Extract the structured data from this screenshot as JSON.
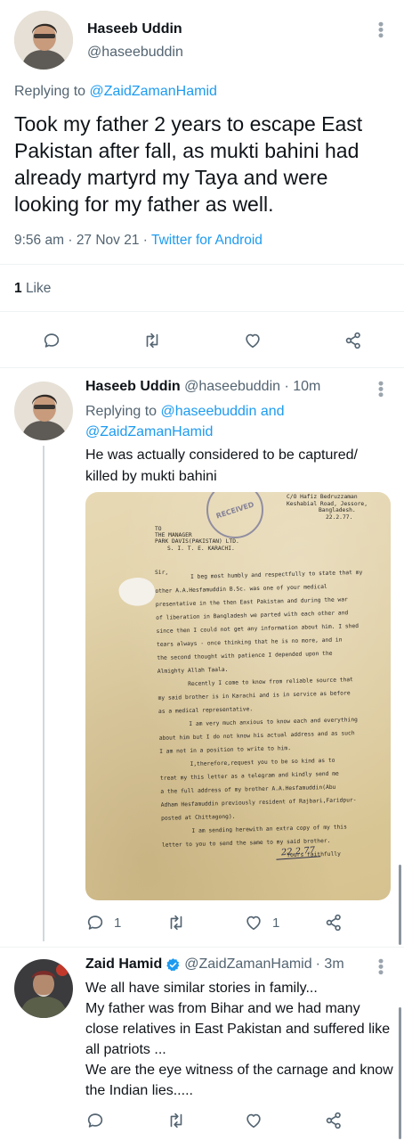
{
  "main_tweet": {
    "author_name": "Haseeb Uddin",
    "handle": "@haseebuddin",
    "replying_prefix": "Replying to",
    "replying_to": "@ZaidZamanHamid",
    "text": "Took my father 2 years to escape East Pakistan after fall, as mukti bahini had already martyrd my Taya and were looking for my father as well.",
    "time": "9:56 am",
    "date": "27 Nov 21",
    "source": "Twitter for Android",
    "sep": "·",
    "likes_count": "1",
    "likes_label": "Like"
  },
  "reply1": {
    "author_name": "Haseeb Uddin",
    "handle": "@haseebuddin",
    "age": "· 10m",
    "replying_prefix": "Replying to",
    "replying_to_1": "@haseebuddin",
    "replying_and": "and",
    "replying_to_2": "@ZaidZamanHamid",
    "text": "He was actually considered to be captured/ killed by mukti bahini",
    "reply_count": "1",
    "like_count": "1",
    "letter": {
      "stamp": "RECEIVED",
      "address": [
        "C/O Hafiz Bedruzzaman",
        "Keshabial Road, Jessore,",
        "Bangladesh.",
        "22.2.77."
      ],
      "to": [
        "TO",
        "THE MANAGER",
        "PARK DAVIS(PAKISTAN) LTD.",
        "S. I. T. E. KARACHI."
      ],
      "salutation": "Sir,",
      "body": [
        "I beg most humbly and respectfully to state that my",
        "other A.A.Hesfamuddin B.Sc. was one of your medical",
        "presentative in the then East Pakistan and during the war",
        "of liberation in Bangladesh we parted with each other and",
        "since then I could not get any information about him. I shed",
        "tears always - once thinking that he is no more, and in",
        "the second thought with patience I depended upon the",
        "Almighty Allah Taala.",
        "Recently I come to know from reliable source that",
        "my said brother is in Karachi and is in service as before",
        "as a medical representative.",
        "I am very much anxious to know each and everything",
        "about him but I do not know his actual address and as such",
        "I am not in a position to write to him.",
        "I,therefore,request you to be so kind as to",
        "treat my this letter as a telegram and kindly send me",
        "a the full address of my brother A.A.Hesfamuddin(Abu",
        "Adham Hesfamuddin previously resident of Rajbari,Faridpur-",
        "posted at Chittagong).",
        "I am sending herewith an extra copy of my this",
        "letter to you to send the same to my said brother.",
        "Yours faithfully"
      ],
      "signature": "22.2.77"
    }
  },
  "reply2": {
    "author_name": "Zaid Hamid",
    "handle": "@ZaidZamanHamid",
    "age": "· 3m",
    "lines": [
      "We all have similar stories in family...",
      "My father was from Bihar and we had many close relatives in East Pakistan and suffered like all patriots ...",
      "We are the eye witness of the carnage and know the Indian lies....."
    ]
  },
  "colors": {
    "accent": "#1d9bf0",
    "text": "#0f1419",
    "muted": "#536471",
    "divider": "#eff3f4",
    "verified": "#1d9bf0"
  },
  "icons": [
    "more-icon",
    "reply-icon",
    "retweet-icon",
    "like-icon",
    "share-icon",
    "verified-icon"
  ]
}
